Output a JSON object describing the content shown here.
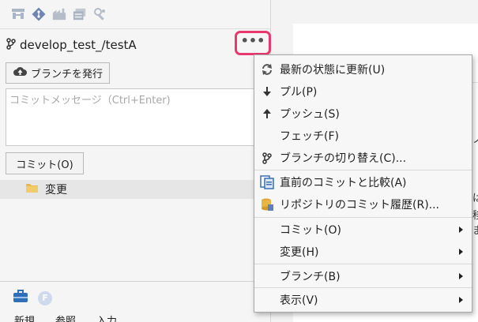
{
  "colors": {
    "accent": "#e8386d",
    "panel": "#f5f5f5",
    "menu_bg": "#f7f7f7"
  },
  "toolbar": {
    "icons": [
      "branch-graph-icon",
      "git-diamond-icon",
      "factory-icon",
      "server-stack-icon",
      "tools-icon"
    ]
  },
  "branch": {
    "icon": "branch-icon",
    "name": "develop_test_/testA"
  },
  "more_button": {
    "icon": "more-icon",
    "label": "•••"
  },
  "publish_button": {
    "icon": "cloud-upload-icon",
    "label": "ブランチを発行"
  },
  "commit_message": {
    "placeholder": "コミットメッセージ（Ctrl+Enter)"
  },
  "commit_button": {
    "label": "コミット(O)"
  },
  "changes": {
    "icon": "folder-icon",
    "label": "変更"
  },
  "bottom": {
    "icons": [
      "toolbox-icon",
      "f-badge-icon"
    ],
    "f_badge_letter": "F",
    "tabs": [
      "新規",
      "参照",
      "入力"
    ]
  },
  "context_menu": {
    "items": [
      {
        "label": "最新の状態に更新(U)",
        "icon": "refresh-icon",
        "submenu": false
      },
      {
        "label": "プル(P)",
        "icon": "arrow-down-icon",
        "submenu": false
      },
      {
        "label": "プッシュ(S)",
        "icon": "arrow-up-icon",
        "submenu": false
      },
      {
        "label": "フェッチ(F)",
        "icon": "",
        "submenu": false
      },
      {
        "label": "ブランチの切り替え(C)...",
        "icon": "branch-icon",
        "submenu": false
      },
      {
        "label": "直前のコミットと比較(A)",
        "icon": "compare-icon",
        "submenu": false
      },
      {
        "label": "リポジトリのコミット履歴(R)...",
        "icon": "repository-history-icon",
        "submenu": false
      },
      {
        "label": "コミット(O)",
        "icon": "",
        "submenu": true
      },
      {
        "label": "変更(H)",
        "icon": "",
        "submenu": true
      },
      {
        "label": "ブランチ(B)",
        "icon": "",
        "submenu": true
      },
      {
        "label": "表示(V)",
        "icon": "",
        "submenu": true
      }
    ]
  },
  "background_fragments": [
    "は",
    "移",
    "ま",
    "ノ"
  ]
}
